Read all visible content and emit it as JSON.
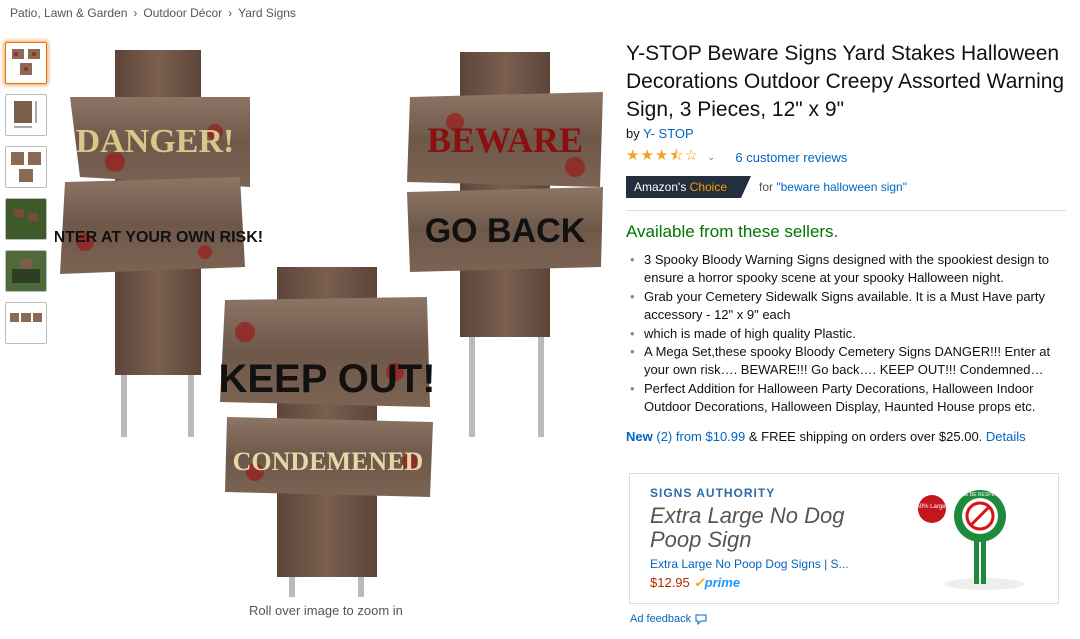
{
  "breadcrumb": [
    "Patio, Lawn & Garden",
    "Outdoor Décor",
    "Yard Signs"
  ],
  "breadcrumb_sep": "›",
  "gallery": {
    "zoom_hint": "Roll over image to zoom in",
    "signs": {
      "danger": "DANGER!",
      "enter": "ENTER AT YOUR OWN RISK!",
      "beware": "BEWARE",
      "goback": "GO BACK",
      "keepout": "KEEP OUT!",
      "condemned": "CONDEMENED"
    }
  },
  "product": {
    "title": "Y-STOP Beware Signs Yard Stakes Halloween Decorations Outdoor Creepy Assorted Warning Sign, 3 Pieces, 12\" x 9\"",
    "by_label": "by",
    "brand": "Y- STOP",
    "rating": 3.5,
    "reviews": "6 customer reviews",
    "badge_amazon": "Amazon's",
    "badge_choice": "Choice",
    "badge_for": "for",
    "badge_query": "\"beware halloween sign\"",
    "availability": "Available from these sellers.",
    "bullets": [
      "3 Spooky Bloody Warning Signs designed with the spookiest design to ensure a horror spooky scene at your spooky Halloween night.",
      "Grab your Cemetery Sidewalk Signs available. It is a Must Have party accessory - 12\" x 9\" each",
      "which is made of high quality Plastic.",
      "A Mega Set,these spooky Bloody Cemetery Signs DANGER!!! Enter at your own risk…. BEWARE!!! Go back…. KEEP OUT!!! Condemned…",
      "Perfect Addition for Halloween Party Decorations, Halloween Indoor Outdoor Decorations, Halloween Display, Haunted House props etc."
    ],
    "offer": {
      "new": "New",
      "count": "(2)",
      "from": "from $10.99",
      "rest": "& FREE shipping on orders over $25.00.",
      "details": "Details"
    }
  },
  "ad": {
    "brand": "SIGNS AUTHORITY",
    "headline": "Extra Large No Dog Poop Sign",
    "product_link": "Extra Large No Poop Dog Signs | S...",
    "price": "$12.95",
    "prime": "prime",
    "badge": "50% Larger",
    "sign_text": "PLEASE BE RESPECTFUL",
    "feedback": "Ad feedback"
  },
  "colors": {
    "link": "#0066c0",
    "available": "#007600",
    "badge_bg": "#232f3e",
    "choice": "#ff9900",
    "star": "#f0a41f",
    "price": "#b12704"
  }
}
